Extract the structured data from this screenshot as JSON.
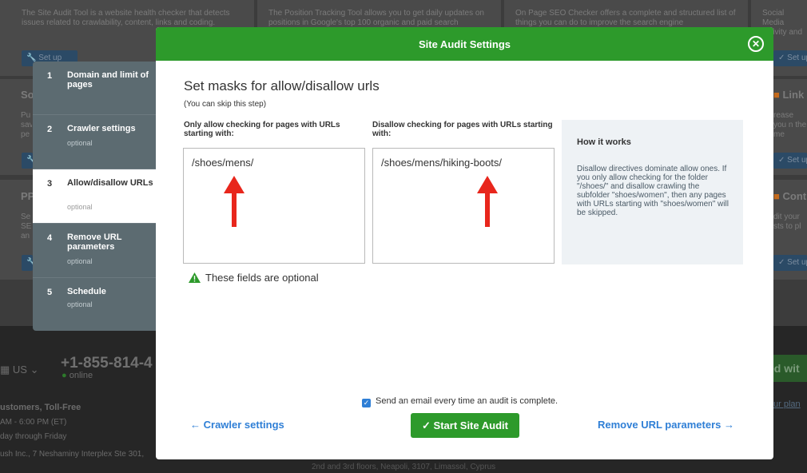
{
  "background": {
    "card1_text": "The Site Audit Tool is a website health checker that detects issues related to crawlability, content, links and coding.",
    "card2_text": "The Position Tracking Tool allows you to get daily updates on positions in Google's top 100 organic and paid search",
    "card3_text": "On Page SEO Checker offers a complete and structured list of things you can do to improve the search engine",
    "card4_text": "Social Media activity and ebook, T",
    "setup_label": "Set up",
    "row2_left_title": "So",
    "row2_left_text": "Pu sav pe",
    "row2_right_title": "Link",
    "row2_right_text": "rease you n the me mmunica",
    "row3_left_title": "PP",
    "row3_left_text": "Se SE an",
    "row3_right_title": "Cont",
    "row3_right_text": "dit your sts to pl",
    "footer": {
      "country": "US",
      "phone": "+1-855-814-4",
      "status": "online",
      "customers": "ustomers, Toll-Free",
      "hours": "AM - 6:00 PM (ET)",
      "days": "day through Friday",
      "address1": "ush Inc., 7 Neshaminy Interplex Ste 301,",
      "address2": "2nd and 3rd floors, Neapoli, 3107, Limassol, Cyprus",
      "right_btn": "ed wit",
      "right_link": "ur plan"
    }
  },
  "steps": [
    {
      "num": "1",
      "label": "Domain and limit of pages",
      "sub": ""
    },
    {
      "num": "2",
      "label": "Crawler settings",
      "sub": "optional"
    },
    {
      "num": "3",
      "label": "Allow/disallow URLs",
      "sub": "optional"
    },
    {
      "num": "4",
      "label": "Remove URL parameters",
      "sub": "optional"
    },
    {
      "num": "5",
      "label": "Schedule",
      "sub": "optional"
    }
  ],
  "modal": {
    "title": "Site Audit Settings",
    "heading": "Set masks for allow/disallow urls",
    "skip_note": "(You can skip this step)",
    "allow_label": "Only allow checking for pages with URLs starting with:",
    "allow_value": "/shoes/mens/",
    "disallow_label": "Disallow checking for pages with URLs starting with:",
    "disallow_value": "/shoes/mens/hiking-boots/",
    "info_title": "How it works",
    "info_text": "Disallow directives dominate allow ones. If you only allow checking for the folder \"/shoes/\" and disallow crawling the subfolder \"shoes/women\", then any pages with URLs starting with \"shoes/women\" will be skipped.",
    "optional_note": "These fields are optional",
    "email_label": "Send an email every time an audit is complete.",
    "start_button": "Start Site Audit",
    "back_link": "Crawler settings",
    "next_link": "Remove URL parameters"
  },
  "colors": {
    "header_green": "#2d9a2b",
    "link_blue": "#2f7fd6",
    "annotation_red": "#e8261c"
  }
}
